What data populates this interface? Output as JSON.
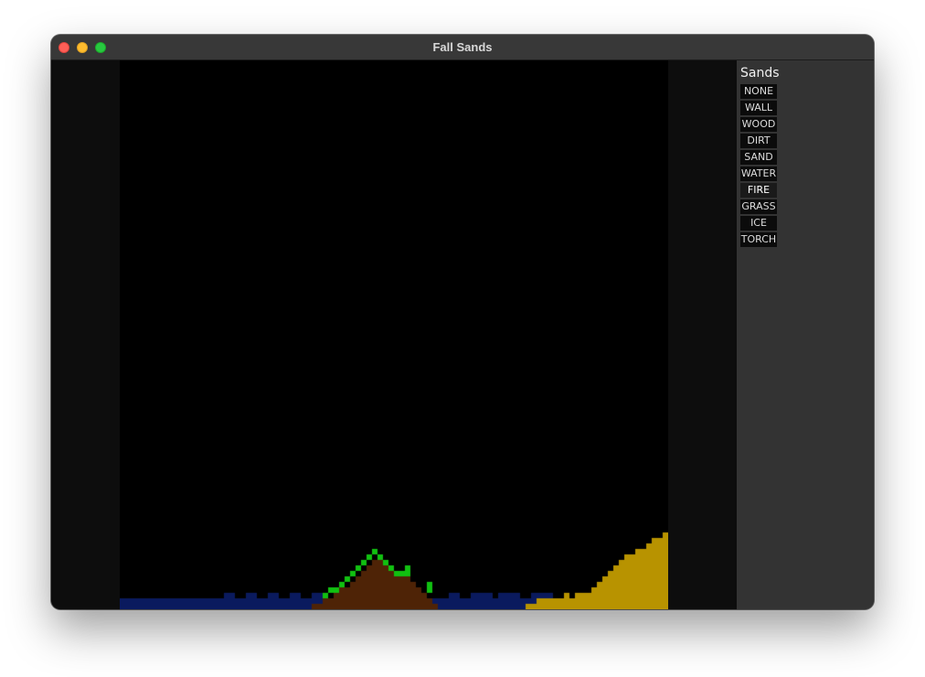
{
  "window": {
    "title": "Fall Sands"
  },
  "sidebar": {
    "title": "Sands",
    "items": [
      {
        "label": "NONE"
      },
      {
        "label": "WALL"
      },
      {
        "label": "WOOD"
      },
      {
        "label": "DIRT"
      },
      {
        "label": "SAND"
      },
      {
        "label": "WATER"
      },
      {
        "label": "FIRE"
      },
      {
        "label": "GRASS"
      },
      {
        "label": "ICE"
      },
      {
        "label": "TORCH"
      }
    ],
    "selected": "FIRE"
  },
  "colors": {
    "empty": "#000000",
    "water": "#0a1a5e",
    "dirt": "#4e2306",
    "grass": "#11c111",
    "sand": "#b89300"
  },
  "grid": {
    "cols": 100,
    "rows": 100,
    "materials": {
      "water": [
        {
          "rows": [
            98,
            99
          ],
          "cols": [
            0,
            99
          ]
        },
        {
          "rows": [
            97,
            97
          ],
          "cols": [
            19,
            20
          ]
        },
        {
          "rows": [
            97,
            97
          ],
          "cols": [
            23,
            24
          ]
        },
        {
          "rows": [
            97,
            97
          ],
          "cols": [
            27,
            28
          ]
        },
        {
          "rows": [
            97,
            97
          ],
          "cols": [
            31,
            32
          ]
        },
        {
          "rows": [
            97,
            97
          ],
          "cols": [
            35,
            36
          ]
        },
        {
          "rows": [
            97,
            97
          ],
          "cols": [
            60,
            61
          ]
        },
        {
          "rows": [
            97,
            97
          ],
          "cols": [
            64,
            67
          ]
        },
        {
          "rows": [
            97,
            97
          ],
          "cols": [
            69,
            72
          ]
        },
        {
          "rows": [
            97,
            97
          ],
          "cols": [
            75,
            78
          ]
        },
        {
          "rows": [
            97,
            97
          ],
          "cols": [
            85,
            86
          ]
        }
      ],
      "dirt": [
        {
          "rows": [
            91,
            91
          ],
          "cols": [
            46,
            47
          ]
        },
        {
          "rows": [
            92,
            92
          ],
          "cols": [
            45,
            48
          ]
        },
        {
          "rows": [
            93,
            93
          ],
          "cols": [
            44,
            50
          ]
        },
        {
          "rows": [
            94,
            94
          ],
          "cols": [
            43,
            52
          ]
        },
        {
          "rows": [
            95,
            95
          ],
          "cols": [
            42,
            53
          ]
        },
        {
          "rows": [
            96,
            96
          ],
          "cols": [
            40,
            54
          ]
        },
        {
          "rows": [
            97,
            97
          ],
          "cols": [
            39,
            55
          ]
        },
        {
          "rows": [
            98,
            98
          ],
          "cols": [
            37,
            56
          ]
        },
        {
          "rows": [
            99,
            99
          ],
          "cols": [
            35,
            57
          ]
        }
      ],
      "grass": [
        {
          "rows": [
            89,
            89
          ],
          "cols": [
            46,
            46
          ]
        },
        {
          "rows": [
            90,
            90
          ],
          "cols": [
            45,
            45
          ]
        },
        {
          "rows": [
            90,
            90
          ],
          "cols": [
            47,
            47
          ]
        },
        {
          "rows": [
            91,
            91
          ],
          "cols": [
            44,
            44
          ]
        },
        {
          "rows": [
            91,
            91
          ],
          "cols": [
            48,
            48
          ]
        },
        {
          "rows": [
            92,
            92
          ],
          "cols": [
            43,
            43
          ]
        },
        {
          "rows": [
            92,
            92
          ],
          "cols": [
            49,
            49
          ]
        },
        {
          "rows": [
            92,
            92
          ],
          "cols": [
            52,
            52
          ]
        },
        {
          "rows": [
            93,
            93
          ],
          "cols": [
            42,
            42
          ]
        },
        {
          "rows": [
            93,
            93
          ],
          "cols": [
            50,
            52
          ]
        },
        {
          "rows": [
            94,
            94
          ],
          "cols": [
            41,
            41
          ]
        },
        {
          "rows": [
            95,
            95
          ],
          "cols": [
            40,
            40
          ]
        },
        {
          "rows": [
            95,
            95
          ],
          "cols": [
            56,
            56
          ]
        },
        {
          "rows": [
            96,
            96
          ],
          "cols": [
            38,
            39
          ]
        },
        {
          "rows": [
            96,
            96
          ],
          "cols": [
            56,
            56
          ]
        },
        {
          "rows": [
            97,
            97
          ],
          "cols": [
            37,
            37
          ]
        }
      ],
      "sand": [
        {
          "rows": [
            86,
            86
          ],
          "cols": [
            99,
            99
          ]
        },
        {
          "rows": [
            87,
            87
          ],
          "cols": [
            97,
            99
          ]
        },
        {
          "rows": [
            88,
            88
          ],
          "cols": [
            96,
            99
          ]
        },
        {
          "rows": [
            89,
            89
          ],
          "cols": [
            94,
            99
          ]
        },
        {
          "rows": [
            90,
            90
          ],
          "cols": [
            92,
            99
          ]
        },
        {
          "rows": [
            91,
            91
          ],
          "cols": [
            91,
            99
          ]
        },
        {
          "rows": [
            92,
            92
          ],
          "cols": [
            90,
            99
          ]
        },
        {
          "rows": [
            93,
            93
          ],
          "cols": [
            89,
            99
          ]
        },
        {
          "rows": [
            94,
            94
          ],
          "cols": [
            88,
            99
          ]
        },
        {
          "rows": [
            95,
            95
          ],
          "cols": [
            87,
            99
          ]
        },
        {
          "rows": [
            96,
            96
          ],
          "cols": [
            86,
            99
          ]
        },
        {
          "rows": [
            97,
            97
          ],
          "cols": [
            81,
            81
          ]
        },
        {
          "rows": [
            97,
            97
          ],
          "cols": [
            83,
            99
          ]
        },
        {
          "rows": [
            98,
            98
          ],
          "cols": [
            76,
            99
          ]
        },
        {
          "rows": [
            99,
            99
          ],
          "cols": [
            74,
            99
          ]
        }
      ]
    }
  }
}
